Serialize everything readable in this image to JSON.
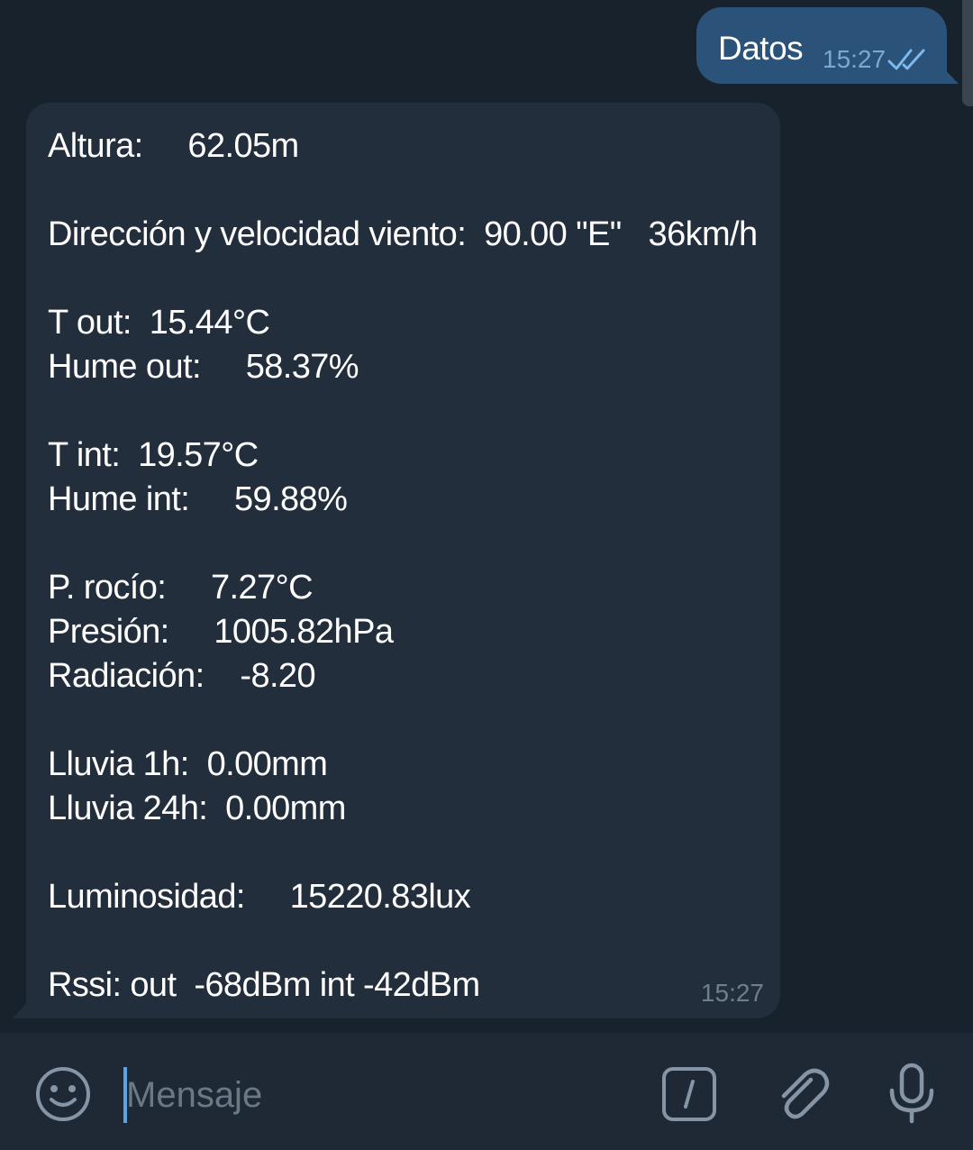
{
  "outgoing": {
    "text": "Datos",
    "time": "15:27",
    "status_icon": "double-check-icon"
  },
  "incoming": {
    "lines": [
      "Altura:     62.05m",
      "",
      "Dirección y velocidad viento:  90.00 \"E\"   36km/h",
      "",
      "T out:  15.44°C",
      "Hume out:     58.37%",
      "",
      "T int:  19.57°C",
      "Hume int:     59.88%",
      "",
      "P. rocío:     7.27°C",
      "Presión:     1005.82hPa",
      "Radiación:    -8.20",
      "",
      "Lluvia 1h:  0.00mm",
      "Lluvia 24h:  0.00mm",
      "",
      "Luminosidad:     15220.83lux",
      "",
      "Rssi: out  -68dBm int -42dBm"
    ],
    "time": "15:27"
  },
  "composer": {
    "placeholder": "Mensaje",
    "value": "",
    "icons": [
      "smile-icon",
      "bot-command-icon",
      "paperclip-icon",
      "microphone-icon"
    ]
  },
  "colors": {
    "background": "#18222d",
    "outgoing_bubble": "#2b5278",
    "incoming_bubble": "#232e3c",
    "input_bar": "#1f2936",
    "icon": "#8595a6",
    "check": "#7db9f0"
  }
}
